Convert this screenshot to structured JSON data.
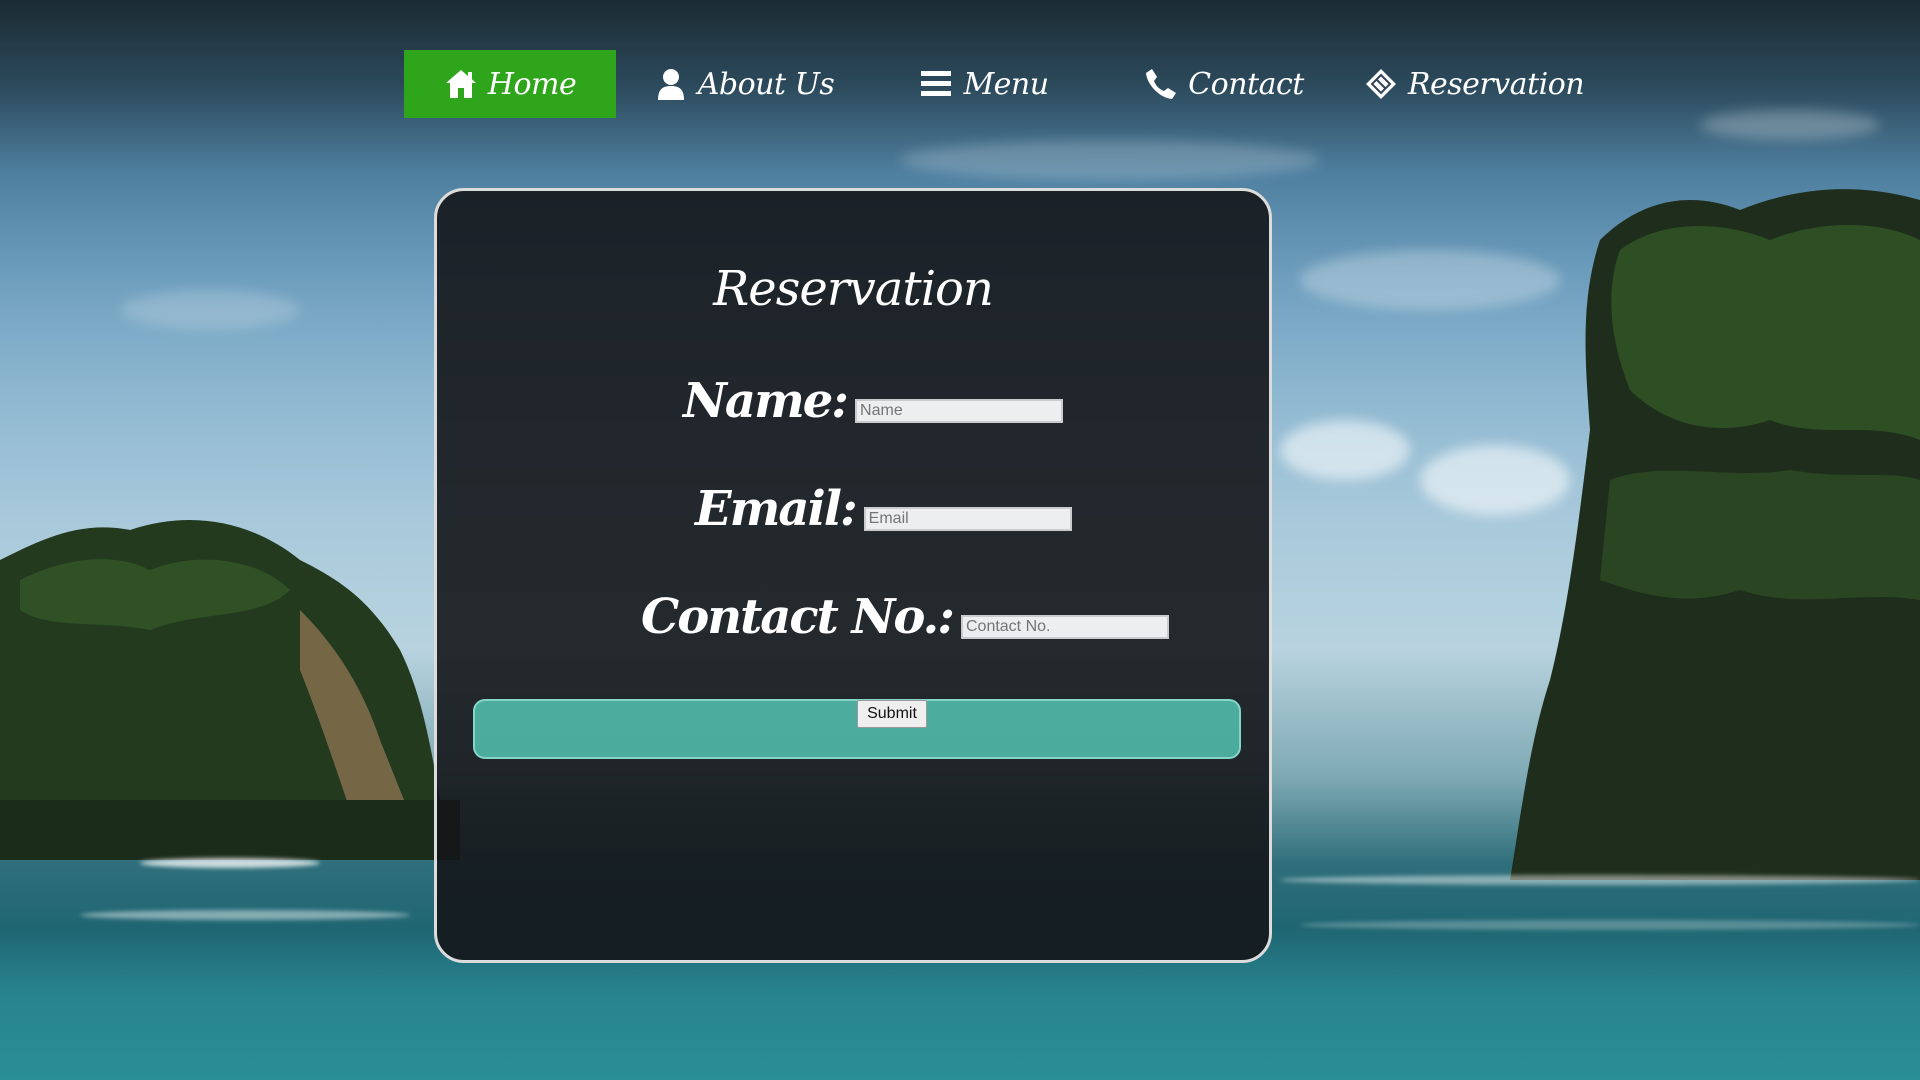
{
  "nav": {
    "items": [
      {
        "label": "Home",
        "icon": "home-icon",
        "active": true
      },
      {
        "label": "About Us",
        "icon": "user-icon",
        "active": false
      },
      {
        "label": "Menu",
        "icon": "menu-icon",
        "active": false
      },
      {
        "label": "Contact",
        "icon": "phone-icon",
        "active": false
      },
      {
        "label": "Reservation",
        "icon": "ticket-icon",
        "active": false
      }
    ],
    "active_color": "#2fa51c"
  },
  "form": {
    "title": "Reservation",
    "name_label": "Name:",
    "name_placeholder": "Name",
    "email_label": "Email:",
    "email_placeholder": "Email",
    "contact_label": "Contact No.:",
    "contact_placeholder": "Contact No.",
    "submit_label": "Submit",
    "submit_bar_color": "#53c4b2"
  }
}
